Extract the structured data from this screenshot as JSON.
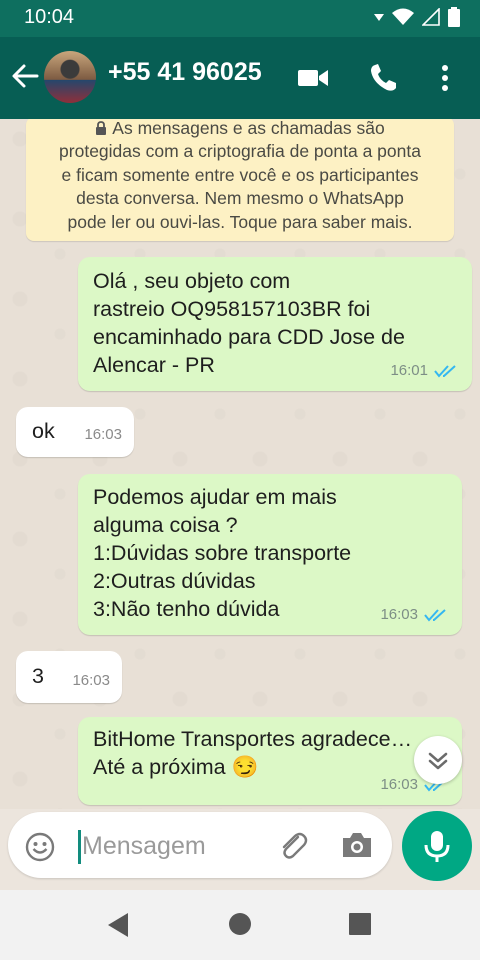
{
  "status_bar": {
    "time": "10:04"
  },
  "header": {
    "contact_name": "+55 41 96025"
  },
  "encryption_notice": {
    "lines": [
      "As mensagens e as chamadas são",
      "protegidas com a criptografia de ponta a ponta",
      "e ficam somente entre você e os participantes",
      "desta conversa. Nem mesmo o WhatsApp",
      "pode ler ou ouvi-las. Toque para saber mais."
    ]
  },
  "messages": [
    {
      "direction": "out",
      "text": "Olá , seu objeto com\nrastreio OQ958157103BR foi\nencaminhado para CDD Jose de\nAlencar - PR",
      "time": "16:01",
      "status": "read"
    },
    {
      "direction": "in",
      "text": "ok",
      "time": "16:03"
    },
    {
      "direction": "out",
      "text": "Podemos ajudar em mais\nalguma coisa ?\n1:Dúvidas sobre transporte\n2:Outras dúvidas\n3:Não tenho dúvida",
      "time": "16:03",
      "status": "read"
    },
    {
      "direction": "in",
      "text": "3",
      "time": "16:03"
    },
    {
      "direction": "out",
      "text": "BitHome Transportes agradece…\nAté a próxima 😏",
      "time": "16:03",
      "status": "read"
    }
  ],
  "composer": {
    "placeholder": "Mensagem"
  },
  "colors": {
    "header": "#075e54",
    "outgoing_bubble": "#dcf8c6",
    "accent": "#00a884",
    "read_ticks": "#34b7f1"
  },
  "icons": [
    "back-arrow-icon",
    "video-call-icon",
    "voice-call-icon",
    "overflow-menu-icon",
    "lock-icon",
    "emoji-icon",
    "attach-icon",
    "camera-icon",
    "mic-icon",
    "chevron-double-down-icon",
    "nav-back-icon",
    "nav-home-icon",
    "nav-recents-icon"
  ]
}
